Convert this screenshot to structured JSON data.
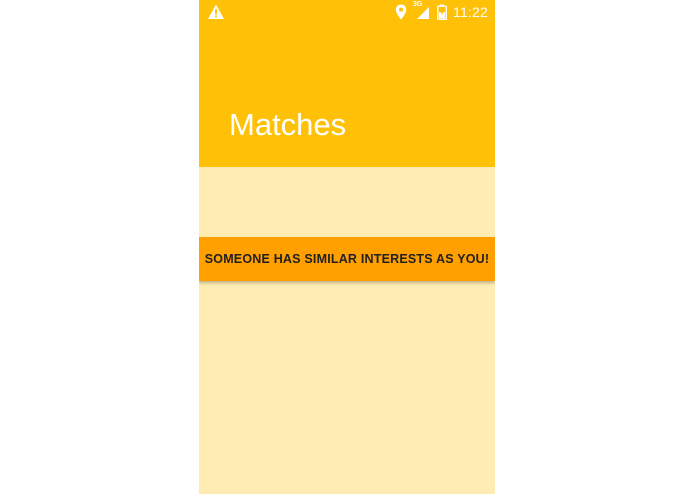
{
  "status_bar": {
    "time": "11:22",
    "network_label": "3G",
    "icons": [
      "warning-icon",
      "location-icon",
      "signal-icon",
      "battery-icon"
    ]
  },
  "app_bar": {
    "title": "Matches",
    "color": "#FFC107"
  },
  "content": {
    "background_color": "#FFECB3",
    "match_banner": {
      "text": "SOMEONE HAS SIMILAR INTERESTS AS YOU!",
      "color": "#FFA000"
    }
  }
}
